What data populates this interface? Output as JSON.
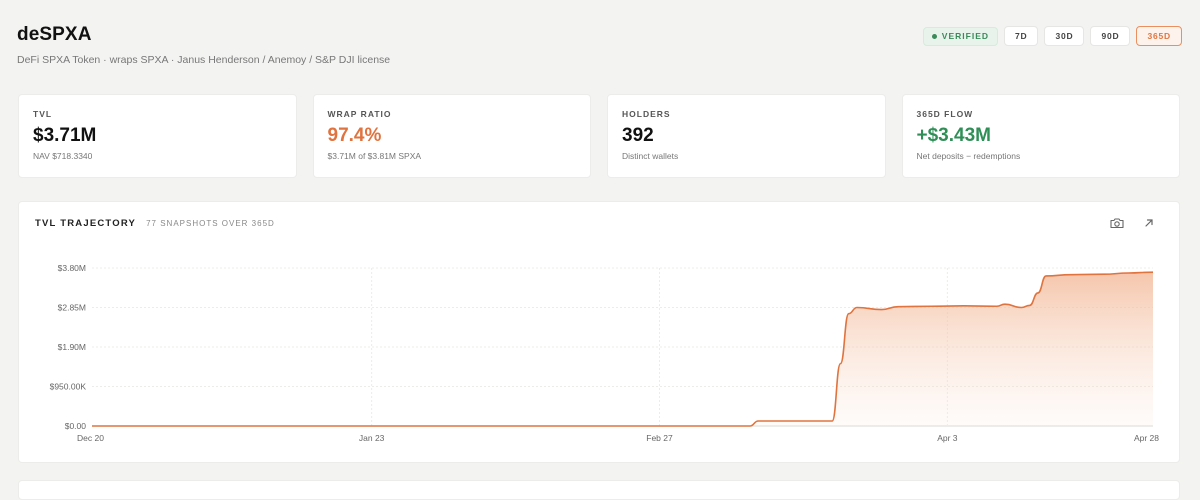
{
  "header": {
    "title": "deSPXA",
    "subtitle": "DeFi SPXA Token · wraps SPXA · Janus Henderson / Anemoy / S&P DJI license",
    "badge": "VERIFIED",
    "ranges": [
      "7D",
      "30D",
      "90D",
      "365D"
    ],
    "active_range": "365D"
  },
  "cards": [
    {
      "label": "TVL",
      "value": "$3.71M",
      "sub": "NAV $718.3340"
    },
    {
      "label": "WRAP RATIO",
      "value": "97.4%",
      "sub": "$3.71M of $3.81M SPXA"
    },
    {
      "label": "HOLDERS",
      "value": "392",
      "sub": "Distinct wallets"
    },
    {
      "label": "365D FLOW",
      "value": "+$3.43M",
      "sub": "Net deposits − redemptions"
    }
  ],
  "chart_panel": {
    "title": "TVL TRAJECTORY",
    "subtitle": "77 SNAPSHOTS OVER 365D",
    "icons": [
      "camera-icon",
      "expand-arrow-icon"
    ]
  },
  "colors": {
    "accent": "#e0733e",
    "positive": "#2f8f56",
    "verified": "#3b8a5a"
  },
  "chart_data": {
    "type": "area",
    "title": "TVL TRAJECTORY",
    "xlabel": "",
    "ylabel": "",
    "x_ticks": [
      "Dec 20",
      "Jan 23",
      "Feb 27",
      "Apr 3",
      "Apr 28"
    ],
    "y_ticks": [
      "$0.00",
      "$950.00K",
      "$1.90M",
      "$2.85M",
      "$3.80M"
    ],
    "ylim": [
      0,
      3800000
    ],
    "grid": true,
    "series": [
      {
        "name": "",
        "x": [
          "Dec 20",
          "Jan 23",
          "Feb 27",
          "Mar 10",
          "Mar 11",
          "Mar 20",
          "Mar 21",
          "Mar 22",
          "Mar 23",
          "Mar 26",
          "Mar 28",
          "Apr 1",
          "Apr 5",
          "Apr 9",
          "Apr 10",
          "Apr 12",
          "Apr 13",
          "Apr 14",
          "Apr 15",
          "Apr 18",
          "Apr 22",
          "Apr 25",
          "Apr 28"
        ],
        "values": [
          0,
          0,
          0,
          0,
          120000,
          120000,
          1500000,
          2700000,
          2850000,
          2800000,
          2870000,
          2880000,
          2890000,
          2880000,
          2930000,
          2850000,
          2900000,
          3200000,
          3610000,
          3640000,
          3650000,
          3680000,
          3700000
        ]
      }
    ],
    "fill_gradient": true
  }
}
